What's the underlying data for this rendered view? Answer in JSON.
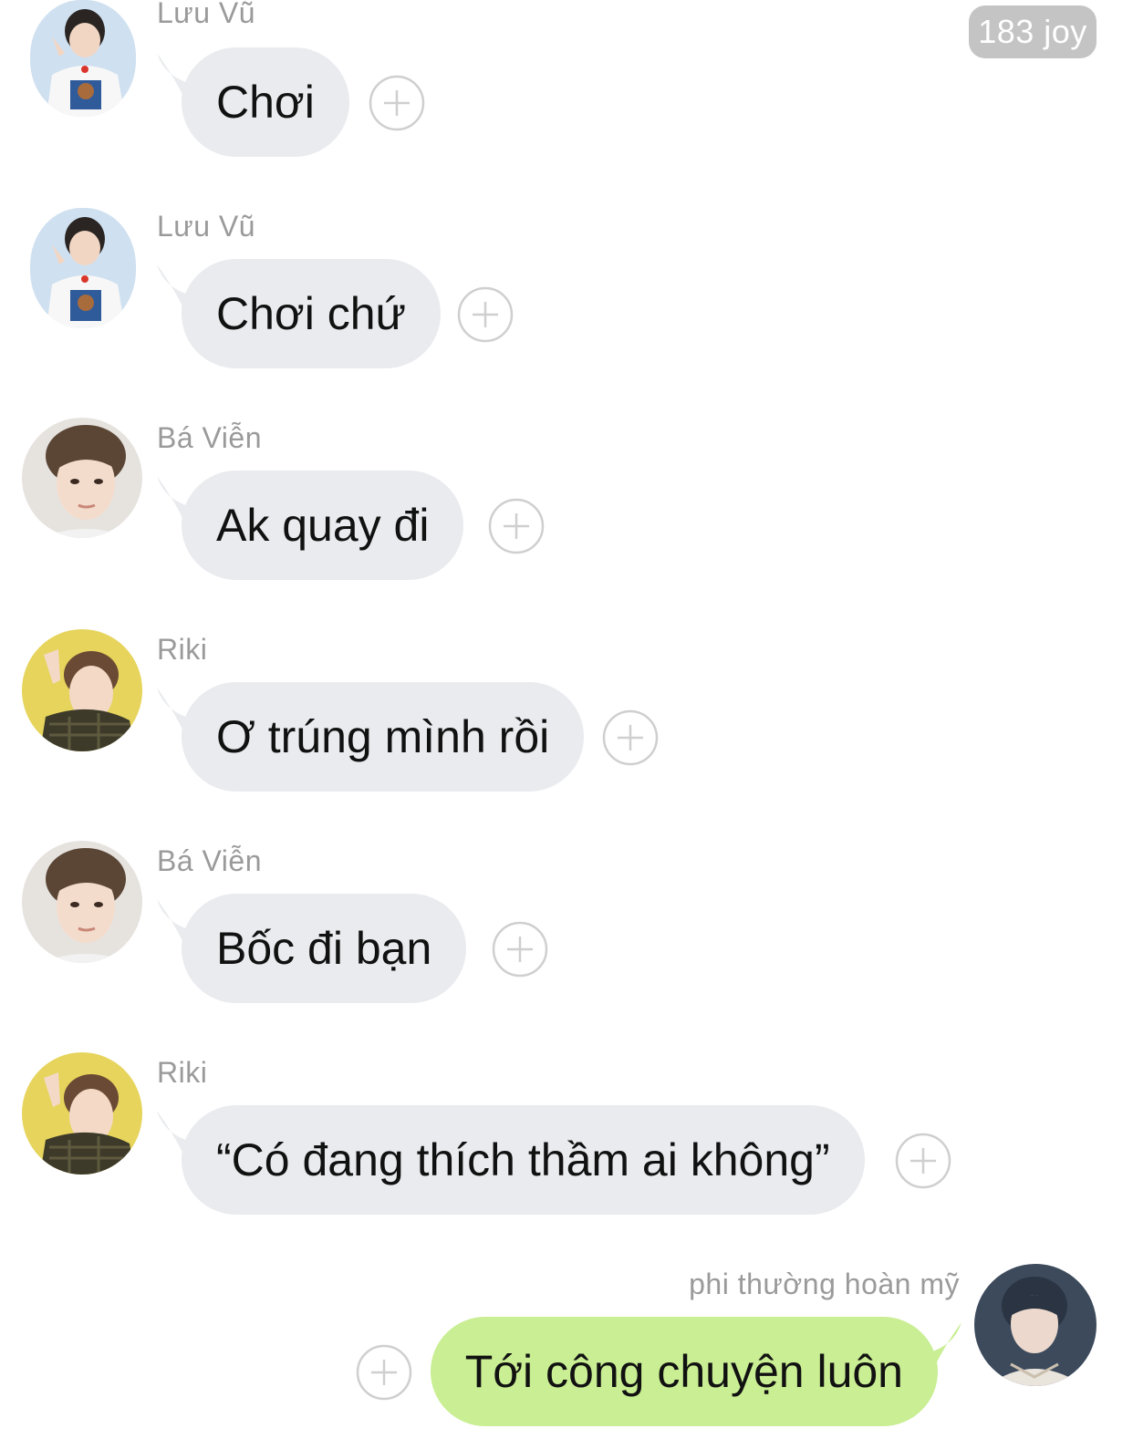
{
  "badge": {
    "count": "183 joy"
  },
  "messages": [
    {
      "sender": "Lưu Vũ",
      "text": "Chơi",
      "direction": "incoming",
      "avatar": "luu-vu-avatar"
    },
    {
      "sender": "Lưu Vũ",
      "text": "Chơi chứ",
      "direction": "incoming",
      "avatar": "luu-vu-avatar"
    },
    {
      "sender": "Bá Viễn",
      "text": "Ak quay đi",
      "direction": "incoming",
      "avatar": "ba-vien-avatar"
    },
    {
      "sender": "Riki",
      "text": "Ơ trúng mình rồi",
      "direction": "incoming",
      "avatar": "riki-avatar"
    },
    {
      "sender": "Bá Viễn",
      "text": "Bốc đi bạn",
      "direction": "incoming",
      "avatar": "ba-vien-avatar"
    },
    {
      "sender": "Riki",
      "text": "“Có đang thích thầm ai không”",
      "direction": "incoming",
      "avatar": "riki-avatar"
    },
    {
      "sender": "phi thường hoàn mỹ",
      "text": "Tới công chuyện luôn",
      "direction": "outgoing",
      "avatar": "self-avatar"
    }
  ],
  "icons": {
    "reaction": "add-reaction-icon"
  },
  "colors": {
    "incoming_bubble": "#e9ebee",
    "outgoing_bubble": "#c9ee93",
    "sender_name": "#9a9a9a",
    "badge": "#c4c4c4"
  }
}
